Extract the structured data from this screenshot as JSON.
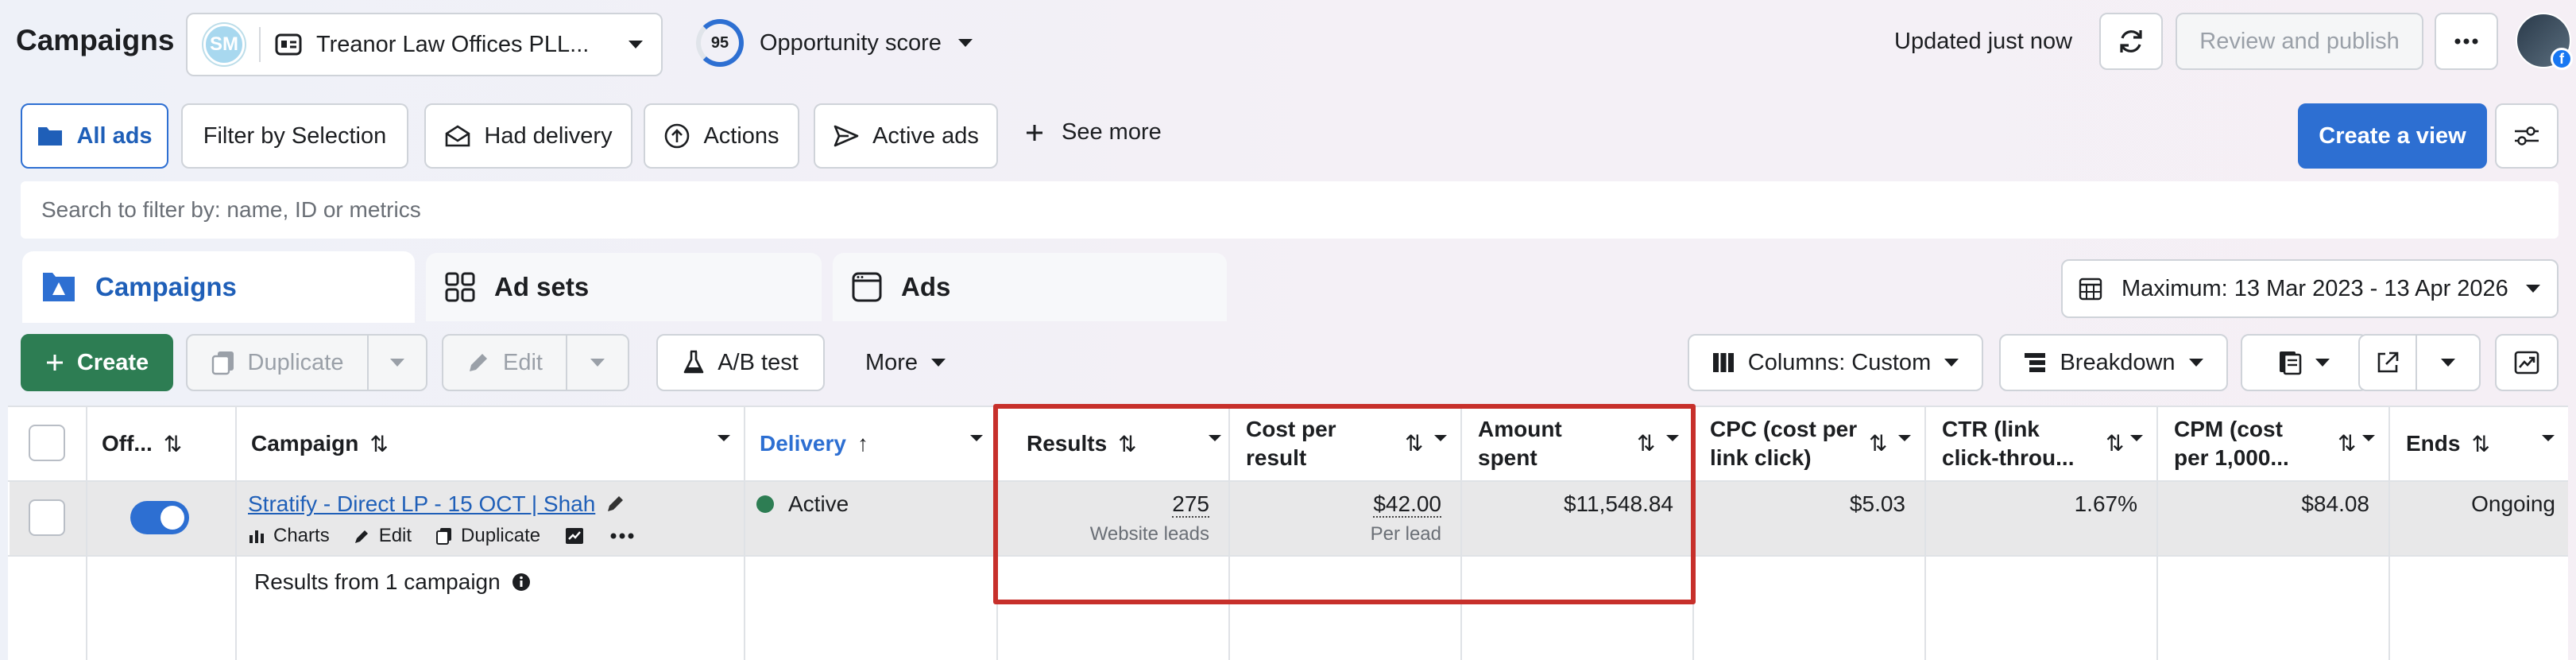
{
  "header": {
    "title": "Campaigns",
    "account_initials": "SM",
    "account_name": "Treanor Law Offices PLL...",
    "opportunity_score": "95",
    "opportunity_label": "Opportunity score",
    "updated_text": "Updated just now",
    "review_publish": "Review and publish"
  },
  "filters": {
    "all_ads": "All ads",
    "filter_by_selection": "Filter by Selection",
    "had_delivery": "Had delivery",
    "actions": "Actions",
    "active_ads": "Active ads",
    "see_more": "See more",
    "create_view": "Create a view"
  },
  "search": {
    "placeholder": "Search to filter by: name, ID or metrics"
  },
  "tabs": [
    {
      "label": "Campaigns"
    },
    {
      "label": "Ad sets"
    },
    {
      "label": "Ads"
    }
  ],
  "date_range": "Maximum: 13 Mar 2023 - 13 Apr 2026",
  "toolbar": {
    "create": "Create",
    "duplicate": "Duplicate",
    "edit": "Edit",
    "ab_test": "A/B test",
    "more": "More",
    "columns": "Columns: Custom",
    "breakdown": "Breakdown"
  },
  "table": {
    "headers": {
      "off_on": "Off...",
      "campaign": "Campaign",
      "delivery": "Delivery",
      "results": "Results",
      "cost_per_result_1": "Cost per",
      "cost_per_result_2": "result",
      "amount_spent_1": "Amount",
      "amount_spent_2": "spent",
      "cpc_1": "CPC (cost per",
      "cpc_2": "link click)",
      "ctr_1": "CTR (link",
      "ctr_2": "click-throu...",
      "cpm_1": "CPM (cost",
      "cpm_2": "per 1,000...",
      "ends": "Ends"
    },
    "row": {
      "campaign_name": "Stratify - Direct LP - 15 OCT | Shah",
      "action_charts": "Charts",
      "action_edit": "Edit",
      "action_duplicate": "Duplicate",
      "delivery": "Active",
      "delivery_color": "#2d7d53",
      "results": "275",
      "results_sub": "Website leads",
      "cost_per_result": "$42.00",
      "cost_per_result_sub": "Per lead",
      "amount_spent": "$11,548.84",
      "cpc": "$5.03",
      "ctr": "1.67%",
      "cpm": "$84.08",
      "ends": "Ongoing"
    },
    "summary": "Results from 1 campaign"
  },
  "colors": {
    "primary_blue": "#2d6fd2",
    "create_green": "#2d7d53",
    "highlight_red": "#c7302b"
  }
}
